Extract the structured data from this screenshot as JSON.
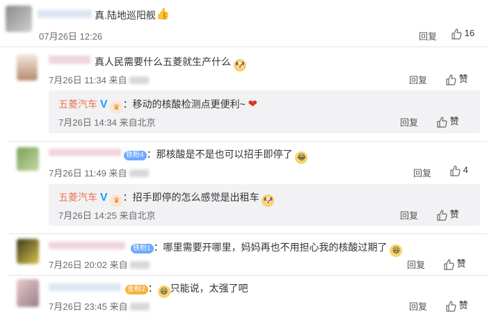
{
  "comments": [
    {
      "author": "真.陆地巡阳舰",
      "time": "07月26日 12:26",
      "reply_label": "回复",
      "likes": "16"
    },
    {
      "text": "真人民需要什么五菱就生产什么",
      "time": "7月26日 11:34 来自",
      "reply_label": "回复",
      "like_label": "赞",
      "reply": {
        "author": "五菱汽车",
        "text": "：移动的核酸检测点更便利~",
        "time": "7月26日 14:34 来自北京",
        "reply_label": "回复",
        "like_label": "赞"
      }
    },
    {
      "badge": "铁粉4",
      "text": "：那核酸是不是也可以招手即停了",
      "time": "7月26日 11:49 来自",
      "reply_label": "回复",
      "likes": "4",
      "reply": {
        "author": "五菱汽车",
        "text": "：招手即停的怎么感觉是出租车",
        "time": "7月26日 14:25 来自北京",
        "reply_label": "回复",
        "like_label": "赞"
      }
    },
    {
      "badge": "铁粉1",
      "text": "：哪里需要开哪里，妈妈再也不用担心我的核酸过期了",
      "time": "7月26日 20:02 来自",
      "reply_label": "回复",
      "like_label": "赞"
    },
    {
      "badge": "金粉2",
      "text": "只能说，太强了吧",
      "time": "7月26日 23:45 来自",
      "reply_label": "回复",
      "like_label": "赞"
    }
  ],
  "colors": {
    "brand": "#eb7350",
    "verified": "#1d9bf0",
    "heart": "#e0322b",
    "iron_fan_badge": "#6fa8ff",
    "gold_fan_badge": "#f3b33d"
  }
}
